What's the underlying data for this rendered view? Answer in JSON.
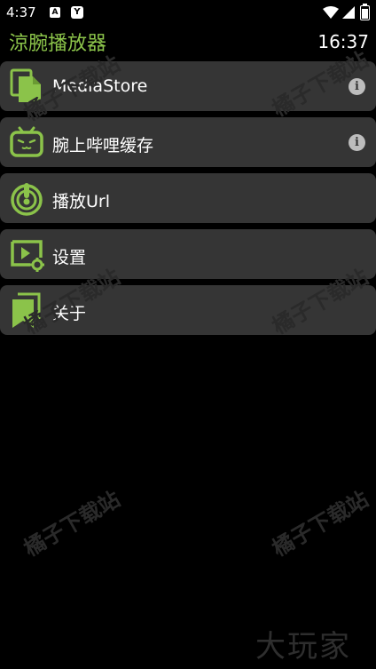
{
  "status_bar": {
    "time": "4:37",
    "notifications": [
      "A",
      "Y"
    ]
  },
  "header": {
    "title": "涼腕播放器",
    "clock": "16:37"
  },
  "menu": {
    "items": [
      {
        "label": "MediaStore",
        "icon": "media-files-icon",
        "has_info": true
      },
      {
        "label": "腕上哔哩缓存",
        "icon": "bilibili-tv-icon",
        "has_info": true
      },
      {
        "label": "播放Url",
        "icon": "play-url-icon",
        "has_info": false
      },
      {
        "label": "设置",
        "icon": "settings-video-icon",
        "has_info": false
      },
      {
        "label": "关于",
        "icon": "about-bookmark-icon",
        "has_info": false
      }
    ],
    "info_glyph": "i"
  },
  "watermark": {
    "text": "橘子下载站"
  },
  "bottom_logo": "大玩家",
  "colors": {
    "accent": "#8bc34a",
    "item_background": "#353535",
    "background": "#000000"
  }
}
